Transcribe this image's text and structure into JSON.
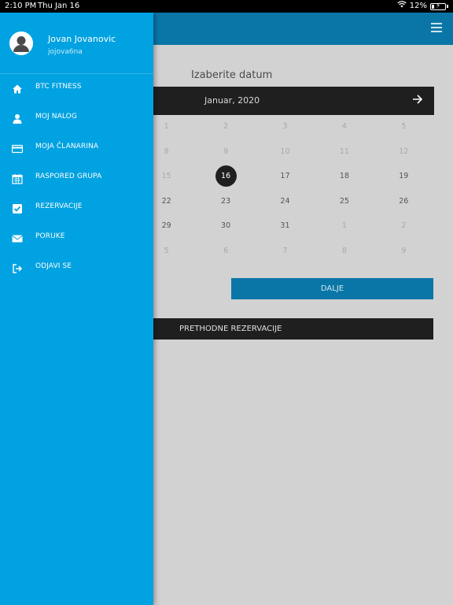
{
  "status_bar": {
    "time": "2:10 PM",
    "date": "Thu Jan 16",
    "battery": "12%"
  },
  "calendar": {
    "title": "Izaberite datum",
    "month": "Januar, 2020",
    "weeks": [
      [
        {
          "d": "1",
          "dim": true
        },
        {
          "d": "2",
          "dim": true
        },
        {
          "d": "3",
          "dim": true
        },
        {
          "d": "4",
          "dim": true
        },
        {
          "d": "5",
          "dim": true
        }
      ],
      [
        {
          "d": "8",
          "dim": true
        },
        {
          "d": "9",
          "dim": true
        },
        {
          "d": "10",
          "dim": true
        },
        {
          "d": "11",
          "dim": true
        },
        {
          "d": "12",
          "dim": true
        }
      ],
      [
        {
          "d": "15",
          "dim": true
        },
        {
          "d": "16",
          "sel": true
        },
        {
          "d": "17"
        },
        {
          "d": "18"
        },
        {
          "d": "19"
        }
      ],
      [
        {
          "d": "22"
        },
        {
          "d": "23"
        },
        {
          "d": "24"
        },
        {
          "d": "25"
        },
        {
          "d": "26"
        }
      ],
      [
        {
          "d": "29"
        },
        {
          "d": "30"
        },
        {
          "d": "31"
        },
        {
          "d": "1",
          "dim": true
        },
        {
          "d": "2",
          "dim": true
        }
      ],
      [
        {
          "d": "5",
          "dim": true
        },
        {
          "d": "6",
          "dim": true
        },
        {
          "d": "7",
          "dim": true
        },
        {
          "d": "8",
          "dim": true
        },
        {
          "d": "9",
          "dim": true
        }
      ]
    ]
  },
  "buttons": {
    "next": "DALJE",
    "previous": "PRETHODNE REZERVACIJE"
  },
  "drawer": {
    "user_name": "Jovan Jovanovic",
    "user_handle": "jojova6na",
    "items": [
      {
        "label": "BTC FITNESS",
        "icon": "home-icon"
      },
      {
        "label": "MOJ NALOG",
        "icon": "user-icon"
      },
      {
        "label": "MOJA ČLANARINA",
        "icon": "credit-card-icon"
      },
      {
        "label": "RASPORED GRUPA",
        "icon": "calendar-icon"
      },
      {
        "label": "REZERVACIJE",
        "icon": "check-square-icon"
      },
      {
        "label": "PORUKE",
        "icon": "envelope-icon"
      },
      {
        "label": "ODJAVI SE",
        "icon": "sign-out-icon"
      }
    ]
  }
}
